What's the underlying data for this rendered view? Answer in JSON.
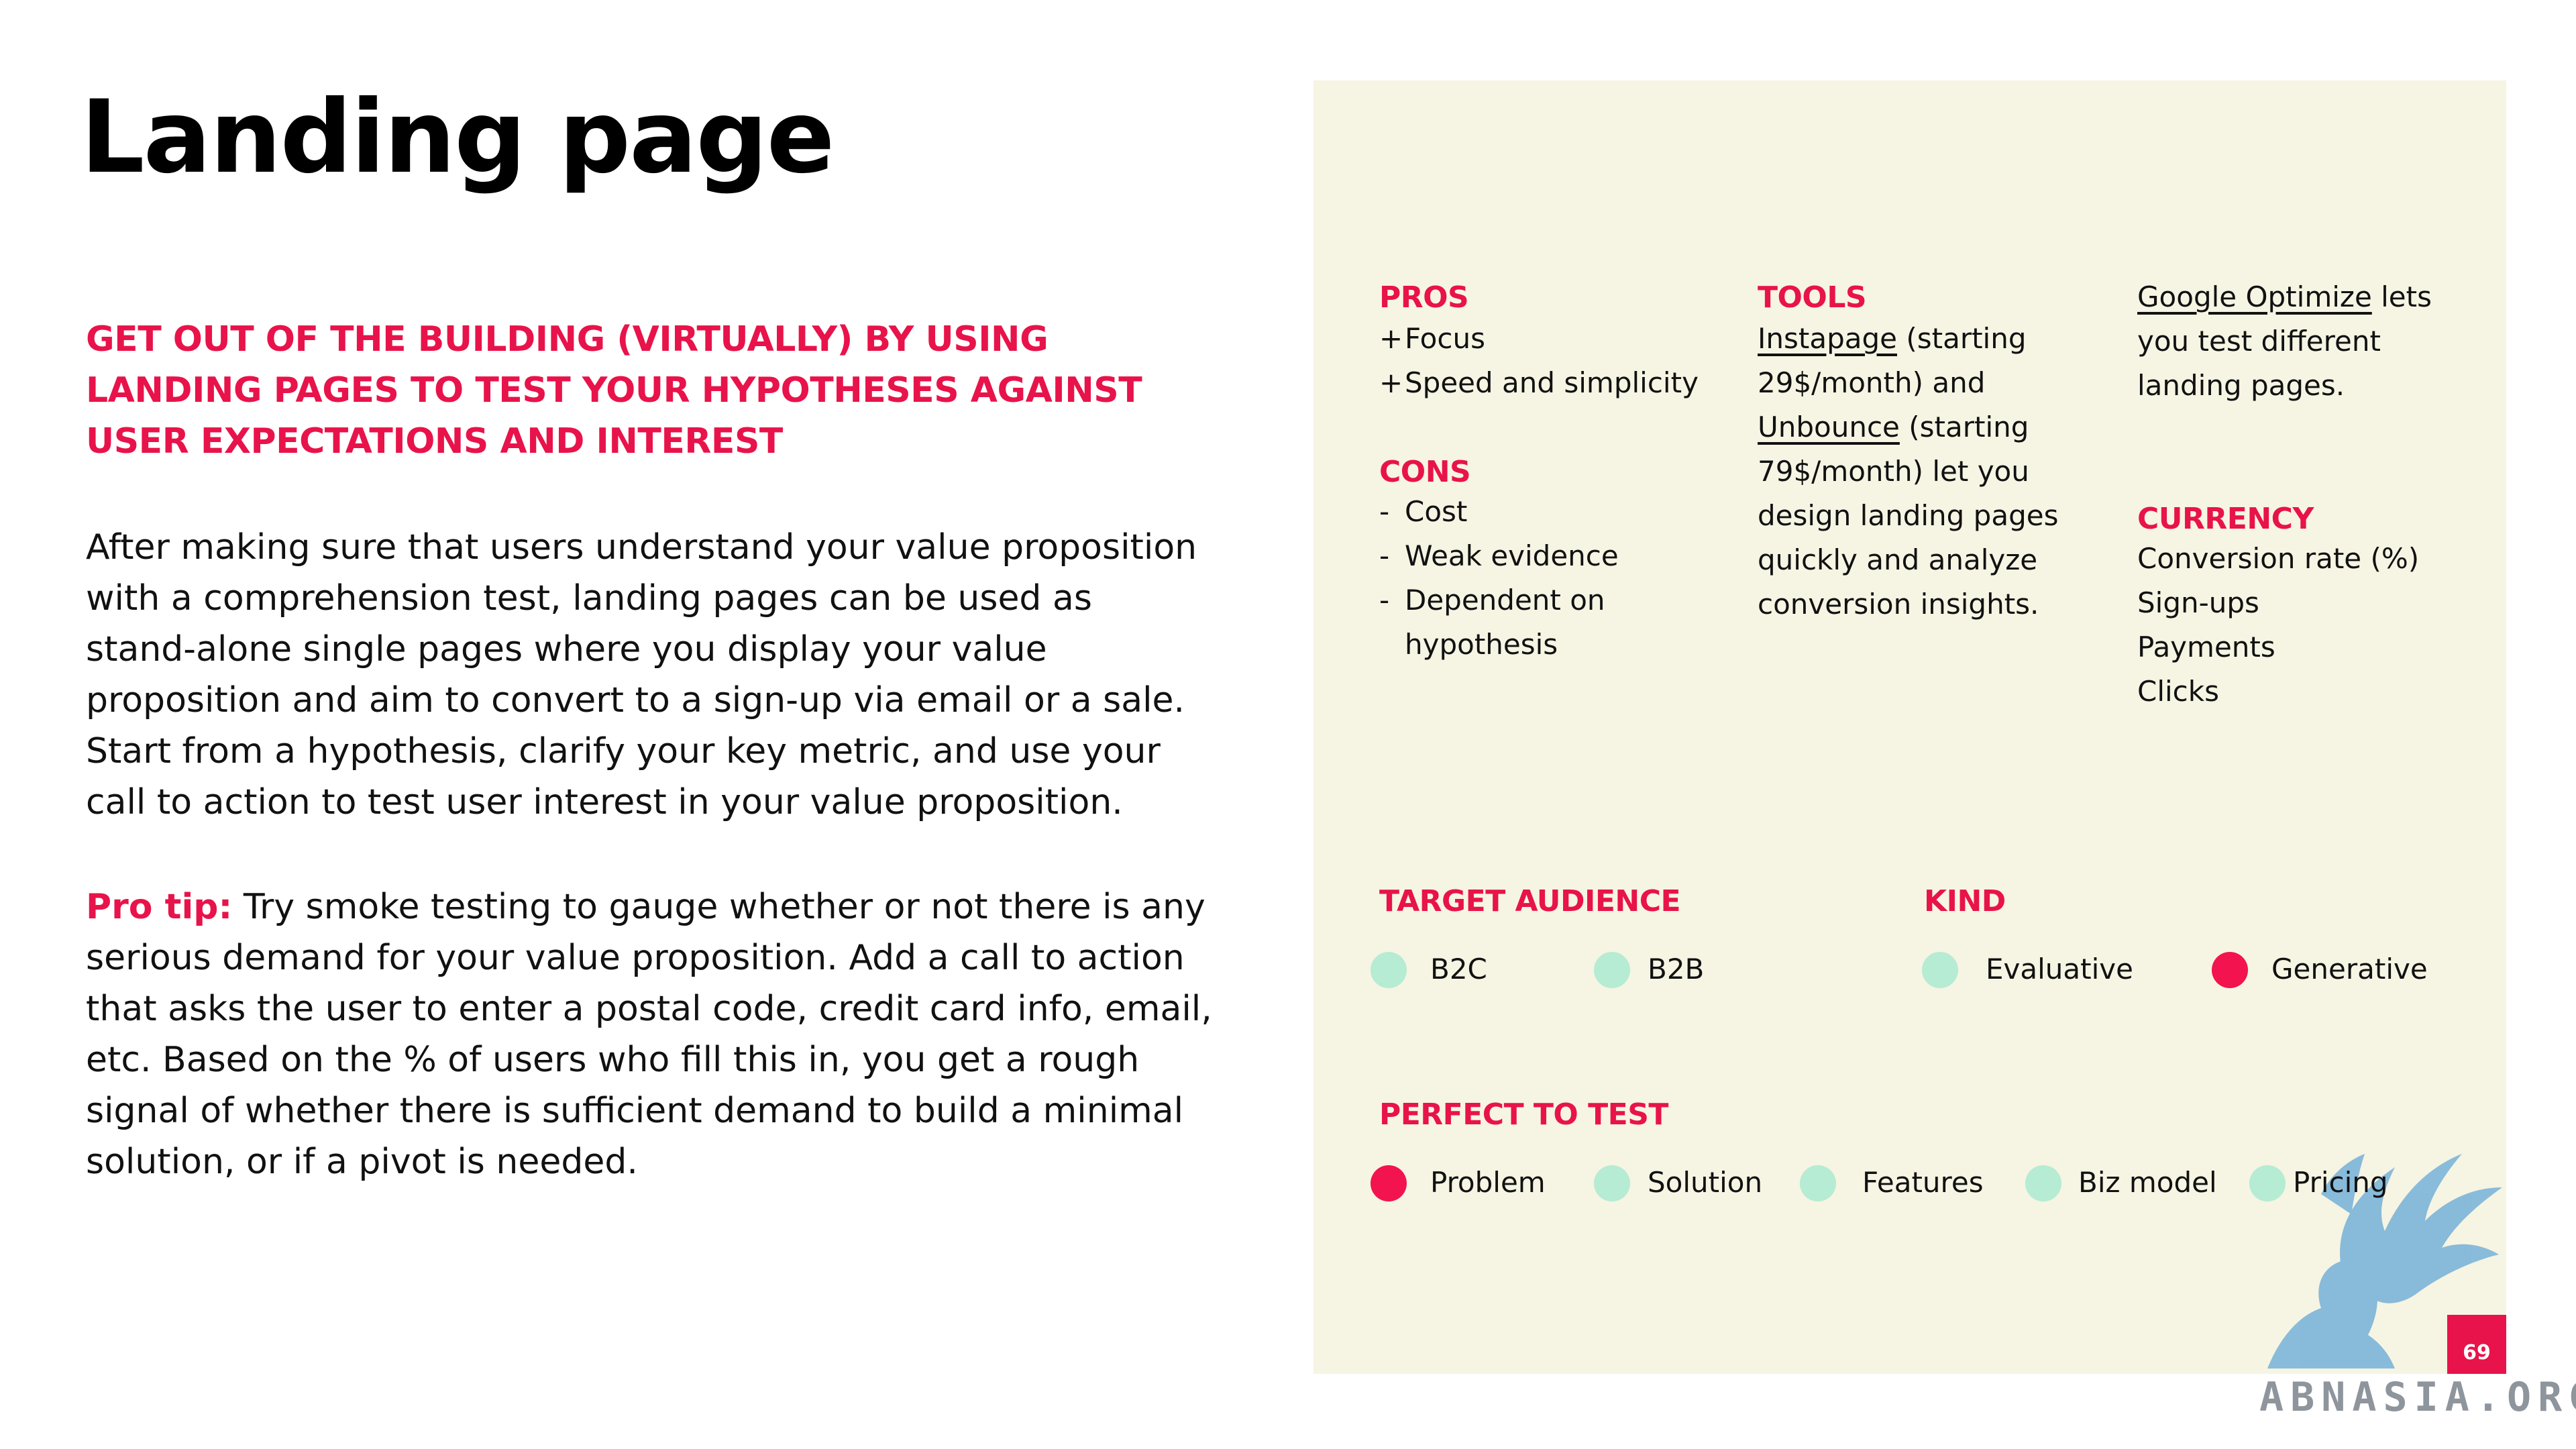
{
  "title": "Landing page",
  "subheading": "GET OUT OF THE BUILDING (VIRTUALLY) BY USING LANDING PAGES TO TEST YOUR HYPOTHESES AGAINST USER EXPECTATIONS AND INTEREST",
  "body": "After making sure that users understand your value proposition with a comprehension test, landing pages can be used as stand-alone single pages where you display your value proposition and aim to convert to a sign-up via email or a sale. Start from a hypothesis, clarify your key metric, and use your call to action to test user interest in your value proposition.",
  "pro_tip": {
    "label": "Pro tip:",
    "text": " Try smoke testing to gauge whether or not there is any serious demand for your value proposition. Add a call to action that asks the user to enter a postal code, credit card info, email, etc. Based on the % of users who fill this in, you get a rough signal of whether there is sufficient demand to build a minimal solution, or if a pivot is needed."
  },
  "pros": {
    "label": "PROS",
    "items": [
      {
        "mark": "+",
        "text": "Focus"
      },
      {
        "mark": "+",
        "text": "Speed and simplicity"
      }
    ]
  },
  "cons": {
    "label": "CONS",
    "items": [
      {
        "mark": "-",
        "text": "Cost"
      },
      {
        "mark": "-",
        "text": "Weak evidence"
      },
      {
        "mark": "-",
        "text": "Dependent on hypothesis"
      }
    ]
  },
  "tools": {
    "label": "TOOLS",
    "link1": "Instapage",
    "text1": " (starting 29$/month) and ",
    "link2": "Unbounce",
    "text2": " (starting 79$/month) let you design landing pages quickly and analyze conversion insights.",
    "link3": "Google Optimize",
    "text3": " lets you test different landing pages."
  },
  "currency": {
    "label": "CURRENCY",
    "items": [
      "Conversion rate (%)",
      "Sign-ups",
      "Payments",
      "Clicks"
    ]
  },
  "target_audience": {
    "label": "TARGET AUDIENCE",
    "options": [
      {
        "label": "B2C",
        "selected": false
      },
      {
        "label": "B2B",
        "selected": false
      }
    ]
  },
  "kind": {
    "label": "KIND",
    "options": [
      {
        "label": "Evaluative",
        "selected": false
      },
      {
        "label": "Generative",
        "selected": true
      }
    ]
  },
  "perfect_to_test": {
    "label": "PERFECT TO TEST",
    "options": [
      {
        "label": "Problem",
        "selected": true
      },
      {
        "label": "Solution",
        "selected": false
      },
      {
        "label": "Features",
        "selected": false
      },
      {
        "label": "Biz model",
        "selected": false
      },
      {
        "label": "Pricing",
        "selected": false
      }
    ]
  },
  "page_number": "69",
  "watermark_text": "ABNASIA.ORG",
  "colors": {
    "accent": "#e8134a",
    "dot_selected": "#f2134f",
    "dot_unselected": "#b5ecd3",
    "panel_bg": "#f6f4e3",
    "watermark_blue": "#7fb6d9"
  }
}
